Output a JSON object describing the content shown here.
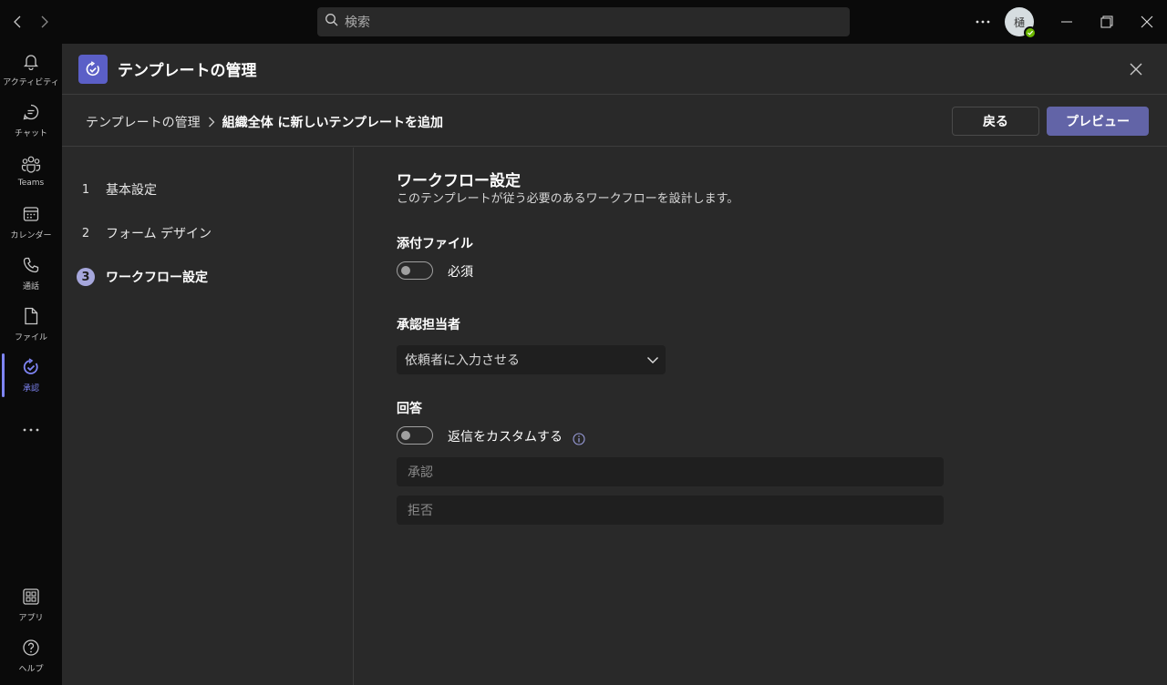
{
  "titlebar": {
    "search_placeholder": "検索",
    "avatar_initial": "樋"
  },
  "rail": {
    "items": [
      {
        "label": "アクティビティ",
        "icon": "bell-icon"
      },
      {
        "label": "チャット",
        "icon": "chat-icon"
      },
      {
        "label": "Teams",
        "icon": "teams-icon"
      },
      {
        "label": "カレンダー",
        "icon": "calendar-icon"
      },
      {
        "label": "通話",
        "icon": "phone-icon"
      },
      {
        "label": "ファイル",
        "icon": "file-icon"
      },
      {
        "label": "承認",
        "icon": "approvals-icon",
        "active": true
      },
      {
        "label": "アプリ",
        "icon": "apps-icon"
      },
      {
        "label": "ヘルプ",
        "icon": "help-icon"
      }
    ]
  },
  "header": {
    "title": "テンプレートの管理"
  },
  "breadcrumb": {
    "parent": "テンプレートの管理",
    "current": "組織全体 に新しいテンプレートを追加"
  },
  "actions": {
    "back_label": "戻る",
    "preview_label": "プレビュー"
  },
  "steps": [
    {
      "num": "1",
      "label": "基本設定"
    },
    {
      "num": "2",
      "label": "フォーム デザイン"
    },
    {
      "num": "3",
      "label": "ワークフロー設定",
      "active": true
    }
  ],
  "workflow": {
    "title": "ワークフロー設定",
    "description": "このテンプレートが従う必要のあるワークフローを設計します。",
    "attachments": {
      "label": "添付ファイル",
      "toggle_label": "必須",
      "toggle_on": false
    },
    "approvers": {
      "label": "承認担当者",
      "selected": "依頼者に入力させる"
    },
    "responses": {
      "label": "回答",
      "toggle_label": "返信をカスタムする",
      "toggle_on": false,
      "approve_placeholder": "承認",
      "reject_placeholder": "拒否"
    }
  },
  "colors": {
    "accent": "#6264a7",
    "accent_light": "#7f85f5",
    "presence": "#6bb700"
  }
}
